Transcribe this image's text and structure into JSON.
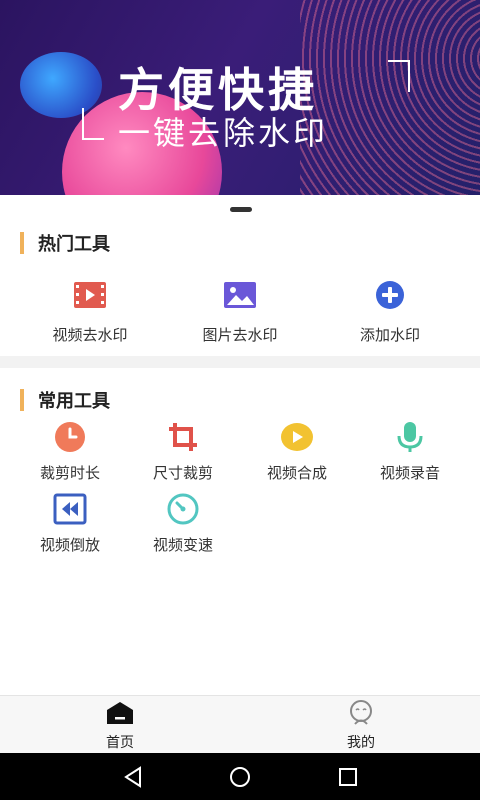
{
  "banner": {
    "title": "方便快捷",
    "subtitle": "一键去除水印"
  },
  "hot_tools": {
    "heading": "热门工具",
    "items": [
      {
        "label": "视频去水印",
        "icon": "video-film-icon",
        "color": "#e15a4f"
      },
      {
        "label": "图片去水印",
        "icon": "image-icon",
        "color": "#6a57d8"
      },
      {
        "label": "添加水印",
        "icon": "plus-circle-icon",
        "color": "#3b63d8"
      }
    ]
  },
  "common_tools": {
    "heading": "常用工具",
    "items": [
      {
        "label": "裁剪时长",
        "icon": "clock-icon",
        "color": "#f07a5a"
      },
      {
        "label": "尺寸裁剪",
        "icon": "crop-icon",
        "color": "#e0524a"
      },
      {
        "label": "视频合成",
        "icon": "play-circle-icon",
        "color": "#f2c231"
      },
      {
        "label": "视频录音",
        "icon": "microphone-icon",
        "color": "#4cc7a3"
      },
      {
        "label": "视频倒放",
        "icon": "rewind-icon",
        "color": "#3b5fc0"
      },
      {
        "label": "视频变速",
        "icon": "speed-dial-icon",
        "color": "#52c6c1"
      }
    ]
  },
  "tabbar": {
    "home_label": "首页",
    "mine_label": "我的"
  },
  "colors": {
    "accent_bar": "#f0b25b",
    "divider": "#f2f2f2"
  }
}
